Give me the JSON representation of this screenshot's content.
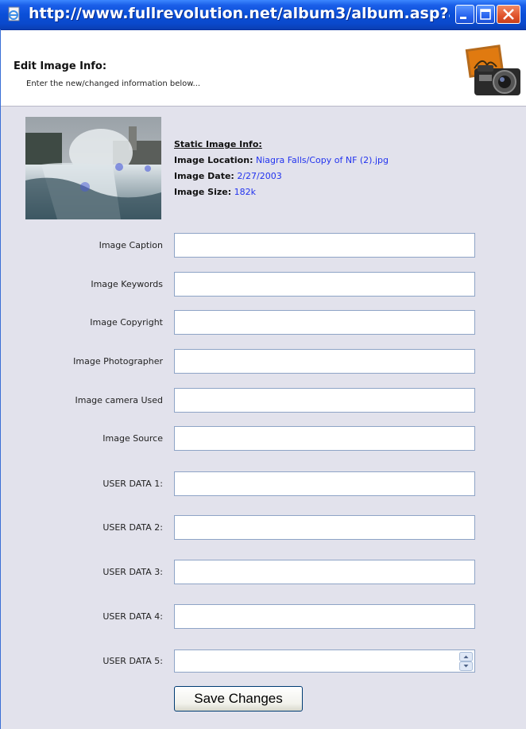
{
  "window": {
    "title": "http://www.fullrevolution.net/album3/album.asp?actio..."
  },
  "header": {
    "title": "Edit Image Info:",
    "subtitle": "Enter the new/changed information below..."
  },
  "static_info": {
    "heading": "Static Image Info:",
    "location_label": "Image Location:",
    "location_value": "Niagra Falls/Copy of NF (2).jpg",
    "date_label": "Image Date:",
    "date_value": "2/27/2003",
    "size_label": "Image Size:",
    "size_value": "182k"
  },
  "form": {
    "fields": [
      {
        "label": "Image Caption",
        "value": ""
      },
      {
        "label": "Image Keywords",
        "value": ""
      },
      {
        "label": "Image Copyright",
        "value": ""
      },
      {
        "label": "Image Photographer",
        "value": ""
      },
      {
        "label": "Image camera Used",
        "value": ""
      },
      {
        "label": "Image Source",
        "value": ""
      },
      {
        "label": "USER DATA 1:",
        "value": ""
      },
      {
        "label": "USER DATA 2:",
        "value": ""
      },
      {
        "label": "USER DATA 3:",
        "value": ""
      },
      {
        "label": "USER DATA 4:",
        "value": ""
      },
      {
        "label": "USER DATA 5:",
        "value": ""
      }
    ],
    "save_label": "Save Changes"
  },
  "colors": {
    "title_bar": "#0a4fd8",
    "link_value": "#2233ee",
    "panel_bg": "#e2e2ec"
  }
}
